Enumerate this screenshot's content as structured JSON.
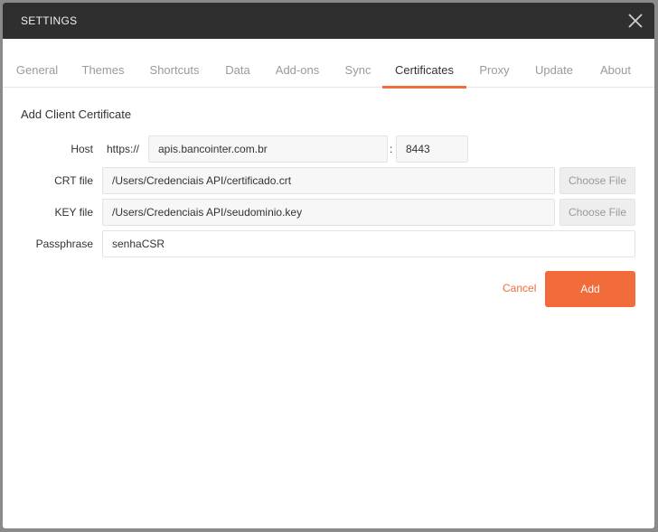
{
  "window": {
    "title": "SETTINGS",
    "close_icon": "close-icon"
  },
  "tabs": [
    {
      "label": "General"
    },
    {
      "label": "Themes"
    },
    {
      "label": "Shortcuts"
    },
    {
      "label": "Data"
    },
    {
      "label": "Add-ons"
    },
    {
      "label": "Sync"
    },
    {
      "label": "Certificates",
      "active": true
    },
    {
      "label": "Proxy"
    },
    {
      "label": "Update"
    },
    {
      "label": "About"
    }
  ],
  "form": {
    "section_title": "Add Client Certificate",
    "host": {
      "label": "Host",
      "prefix": "https://",
      "value": "apis.bancointer.com.br",
      "separator": ":",
      "port": "8443"
    },
    "crt": {
      "label": "CRT file",
      "value": "/Users/Credenciais API/certificado.crt",
      "button": "Choose File"
    },
    "key": {
      "label": "KEY file",
      "value": "/Users/Credenciais API/seudominio.key",
      "button": "Choose File"
    },
    "passphrase": {
      "label": "Passphrase",
      "value": "senhaCSR"
    },
    "cancel_label": "Cancel",
    "add_label": "Add"
  },
  "colors": {
    "accent": "#f26b3a",
    "titlebar": "#2f2f2f"
  }
}
